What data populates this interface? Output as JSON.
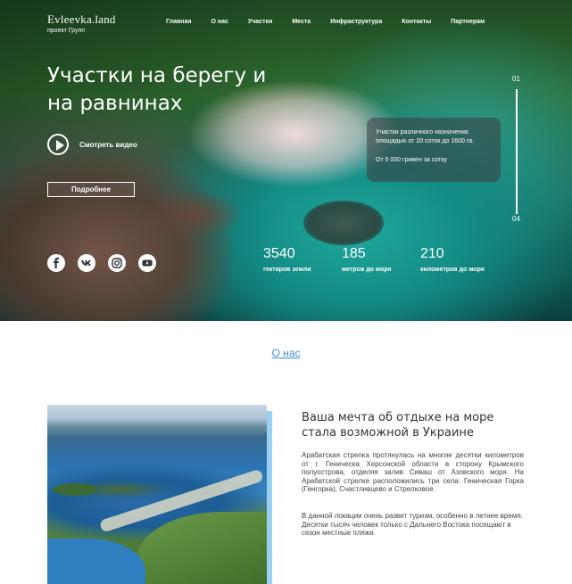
{
  "logo": {
    "name": "Evleevka.land",
    "sub": "проект Групп"
  },
  "nav": [
    "Главная",
    "О нас",
    "Участки",
    "Места",
    "Инфраструктура",
    "Контакты",
    "Партнерам"
  ],
  "hero": {
    "title": "Участки на берегу и на равнинах",
    "video_label": "Смотреть видео",
    "more_label": "Подробнее"
  },
  "social": [
    "facebook-icon",
    "vk-icon",
    "instagram-icon",
    "youtube-icon"
  ],
  "stats": [
    {
      "value": "3540",
      "label": "гектаров земли"
    },
    {
      "value": "185",
      "label": "метров до моря"
    },
    {
      "value": "210",
      "label": "километров до моря"
    }
  ],
  "infobox": {
    "line1": "Участки различного назначения площадью от 20 соток до 1600 га.",
    "line2": "От 5 000 гривен за сотку"
  },
  "slider": {
    "current": "01",
    "last": "04",
    "progress": 1.0
  },
  "about": {
    "link": "О нас",
    "title": "Ваша мечта об отдыхе на море стала возможной в Украине",
    "p1": "Арабатская стрелка протянулась на многие десятки километров от г. Геническа Херсонской области в сторону Крымского полуострова, отделяя залив Сиваш от Азовского моря. На Арабатской стрелке расположились три села: Геническая Горка (Генгорка), Счастливцево и Стрелковое.",
    "p2a": "В данной локации очень развит туризм, особенно в летнее время.",
    "p2b": "Десятки тысяч человек только с Дальнего Востока посещают в сезон местные пляжи."
  }
}
